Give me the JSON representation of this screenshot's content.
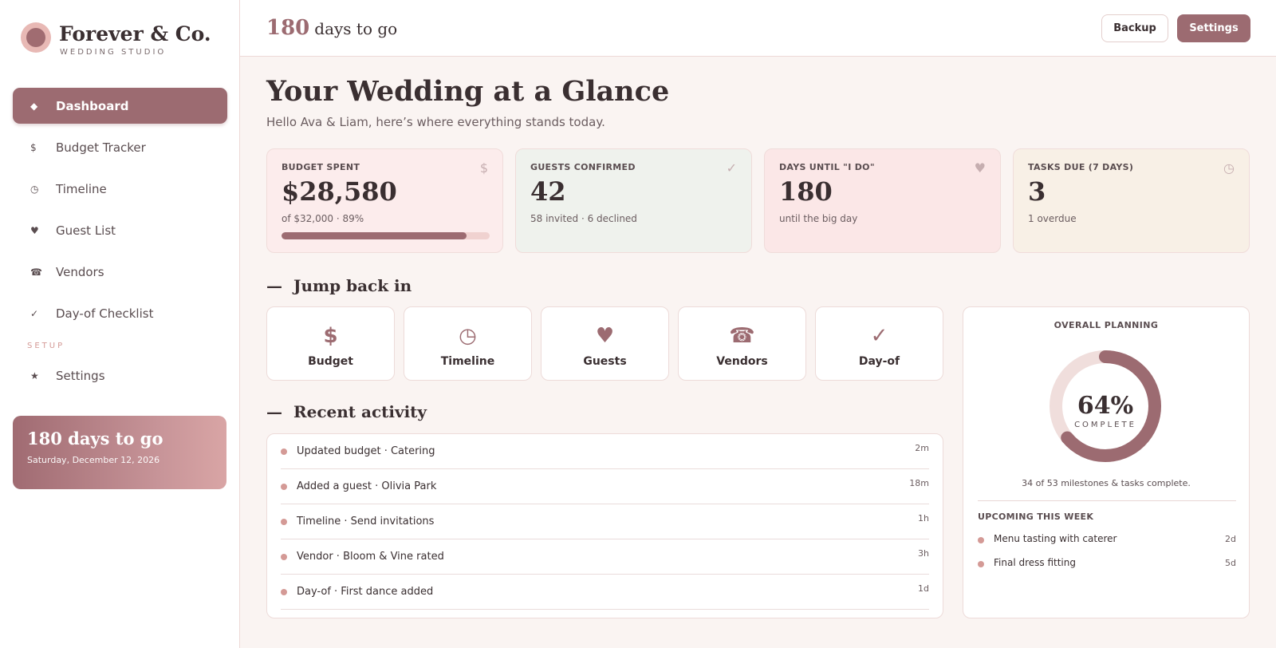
{
  "brand": {
    "name": "Forever & Co.",
    "tagline": "WEDDING STUDIO"
  },
  "sidebar": {
    "items": [
      {
        "icon": "◆",
        "label": "Dashboard",
        "active": true
      },
      {
        "icon": "$",
        "label": "Budget Tracker"
      },
      {
        "icon": "◷",
        "label": "Timeline"
      },
      {
        "icon": "♥",
        "label": "Guest List"
      },
      {
        "icon": "☎",
        "label": "Vendors"
      },
      {
        "icon": "✓",
        "label": "Day-of Checklist"
      }
    ],
    "section_label": "SETUP",
    "settings": {
      "icon": "★",
      "label": "Settings"
    },
    "countdown": {
      "title": "180 days to go",
      "date": "Saturday, December 12, 2026"
    }
  },
  "topbar": {
    "days_number": "180",
    "days_text": "days to go",
    "backup_label": "Backup",
    "settings_label": "Settings"
  },
  "header": {
    "title": "Your Wedding at a Glance",
    "subtitle": "Hello Ava & Liam, here’s where everything stands today."
  },
  "stats": [
    {
      "label": "BUDGET SPENT",
      "icon": "$",
      "value": "$28,580",
      "note": "of $32,000 · 89%",
      "progress": 0.89,
      "bg": "#fcecec"
    },
    {
      "label": "GUESTS CONFIRMED",
      "icon": "✓",
      "value": "42",
      "note": "58 invited · 6 declined",
      "bg": "#eff2ed"
    },
    {
      "label": "DAYS UNTIL \"I DO\"",
      "icon": "♥",
      "value": "180",
      "note": "until the big day",
      "bg": "#fbe7e7"
    },
    {
      "label": "TASKS DUE (7 DAYS)",
      "icon": "◷",
      "value": "3",
      "note": "1 overdue",
      "bg": "#f8f0e6"
    }
  ],
  "jump": {
    "heading": "Jump back in",
    "items": [
      {
        "icon": "$",
        "label": "Budget"
      },
      {
        "icon": "◷",
        "label": "Timeline"
      },
      {
        "icon": "♥",
        "label": "Guests"
      },
      {
        "icon": "☎",
        "label": "Vendors"
      },
      {
        "icon": "✓",
        "label": "Day-of"
      }
    ]
  },
  "activity": {
    "heading": "Recent activity",
    "items": [
      {
        "text": "Updated budget · Catering",
        "time": "2m"
      },
      {
        "text": "Added a guest · Olivia Park",
        "time": "18m"
      },
      {
        "text": "Timeline · Send invitations",
        "time": "1h"
      },
      {
        "text": "Vendor · Bloom & Vine rated",
        "time": "3h"
      },
      {
        "text": "Day-of · First dance added",
        "time": "1d"
      }
    ]
  },
  "planning": {
    "title": "OVERALL PLANNING",
    "percent_label": "64%",
    "percent": 0.64,
    "complete_label": "COMPLETE",
    "note": "34 of 53 milestones & tasks complete.",
    "upcoming_heading": "UPCOMING THIS WEEK",
    "upcoming": [
      {
        "text": "Menu tasting with caterer",
        "time": "2d"
      },
      {
        "text": "Final dress fitting",
        "time": "5d"
      }
    ]
  },
  "colors": {
    "accent": "#9c6b71",
    "accent_light": "#d49a96",
    "track": "#f0dedc"
  }
}
